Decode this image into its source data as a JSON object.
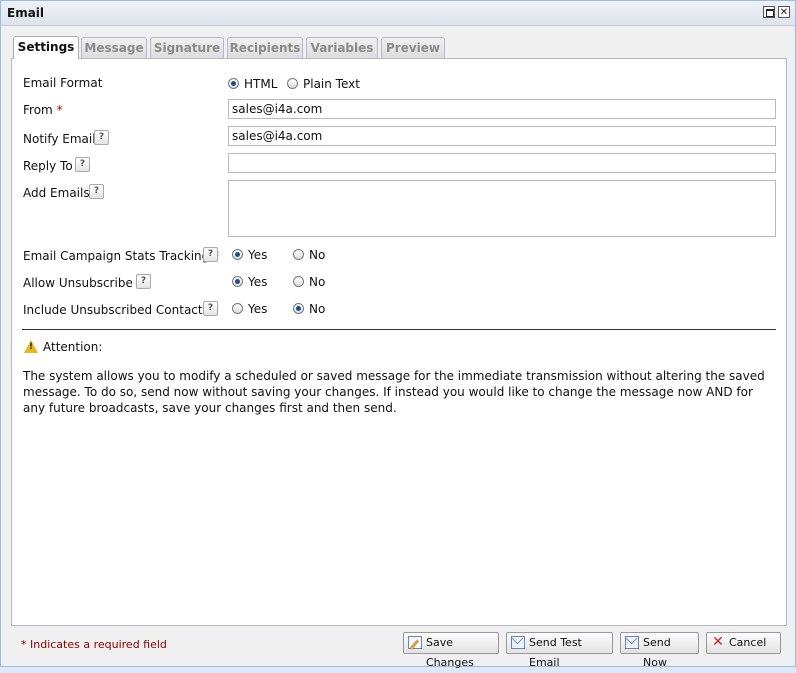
{
  "window": {
    "title": "Email"
  },
  "tabs": [
    {
      "label": "Settings"
    },
    {
      "label": "Message"
    },
    {
      "label": "Signature"
    },
    {
      "label": "Recipients"
    },
    {
      "label": "Variables"
    },
    {
      "label": "Preview"
    }
  ],
  "form": {
    "email_format": {
      "label": "Email Format",
      "options": [
        "HTML",
        "Plain Text"
      ],
      "selected": "HTML"
    },
    "from": {
      "label": "From",
      "value": "sales@i4a.com"
    },
    "notify_email": {
      "label": "Notify Email",
      "value": "sales@i4a.com"
    },
    "reply_to": {
      "label": "Reply To",
      "value": ""
    },
    "add_emails": {
      "label": "Add Emails",
      "value": ""
    },
    "stats_tracking": {
      "label": "Email Campaign Stats Tracking",
      "yes": "Yes",
      "no": "No",
      "selected": "Yes"
    },
    "allow_unsubscribe": {
      "label": "Allow Unsubscribe",
      "yes": "Yes",
      "no": "No",
      "selected": "Yes"
    },
    "include_unsubscribed": {
      "label": "Include Unsubscribed Contacts",
      "yes": "Yes",
      "no": "No",
      "selected": "No"
    },
    "required_mark": "*",
    "help_glyph": "?"
  },
  "attention": {
    "heading": "Attention:",
    "text": "The system allows you to modify a scheduled or saved message for the immediate transmission without altering the saved message. To do so, send now without saving your changes. If instead you would like to change the message now AND for any future broadcasts, save your changes first and then send."
  },
  "footer": {
    "required_note": "* Indicates a required field",
    "buttons": {
      "save": "Save Changes",
      "test": "Send Test Email",
      "send": "Send Now",
      "cancel": "Cancel"
    }
  },
  "icons": {
    "maximize": "maximize-icon",
    "close": "close-icon",
    "help": "help-icon",
    "warning": "warning-icon",
    "save": "edit-note-icon",
    "mail": "envelope-icon",
    "cancel": "red-x-icon"
  },
  "colors": {
    "required": "#cc0000",
    "border": "#99bbe8",
    "footnote": "#8b0000"
  }
}
